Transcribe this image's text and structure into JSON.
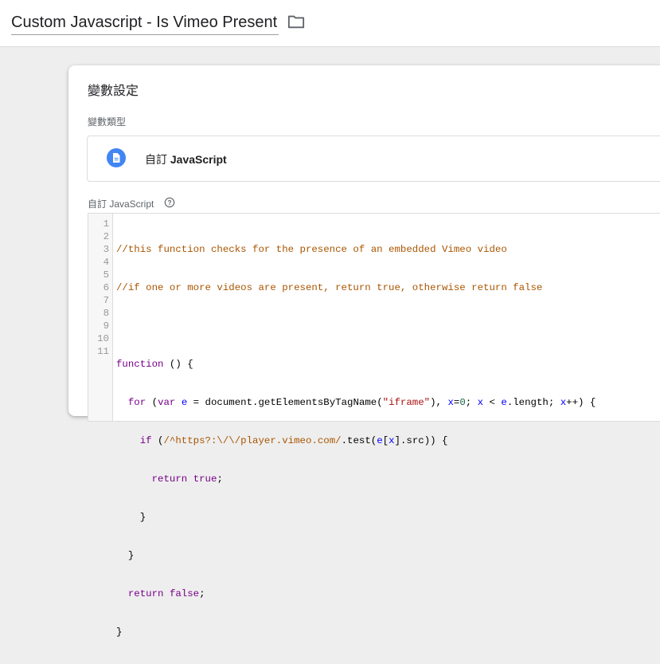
{
  "header": {
    "title": "Custom Javascript - Is Vimeo Present",
    "folder_icon": "folder-icon"
  },
  "card": {
    "title": "變數設定",
    "type_label": "變數類型",
    "type_name_prefix": "自訂",
    "type_name_bold": "JavaScript",
    "type_icon": "document-icon",
    "code_label": "自訂 JavaScript",
    "help_icon": "help-icon"
  },
  "editor": {
    "line_numbers": [
      "1",
      "2",
      "3",
      "4",
      "5",
      "6",
      "7",
      "8",
      "9",
      "10",
      "11"
    ],
    "code": [
      "//this function checks for the presence of an embedded Vimeo video",
      "//if one or more videos are present, return true, otherwise return false",
      "",
      "function () {",
      "  for (var e = document.getElementsByTagName(\"iframe\"), x=0; x < e.length; x++) {",
      "    if (/^https?:\\/\\/player.vimeo.com/.test(e[x].src)) {",
      "      return true;",
      "    }",
      "  }",
      "  return false;",
      "}"
    ]
  },
  "colors": {
    "accent": "#4285f4",
    "comment": "#aa5500",
    "keyword": "#770088",
    "variable": "#0000ff",
    "string": "#aa1111",
    "number": "#116644"
  }
}
